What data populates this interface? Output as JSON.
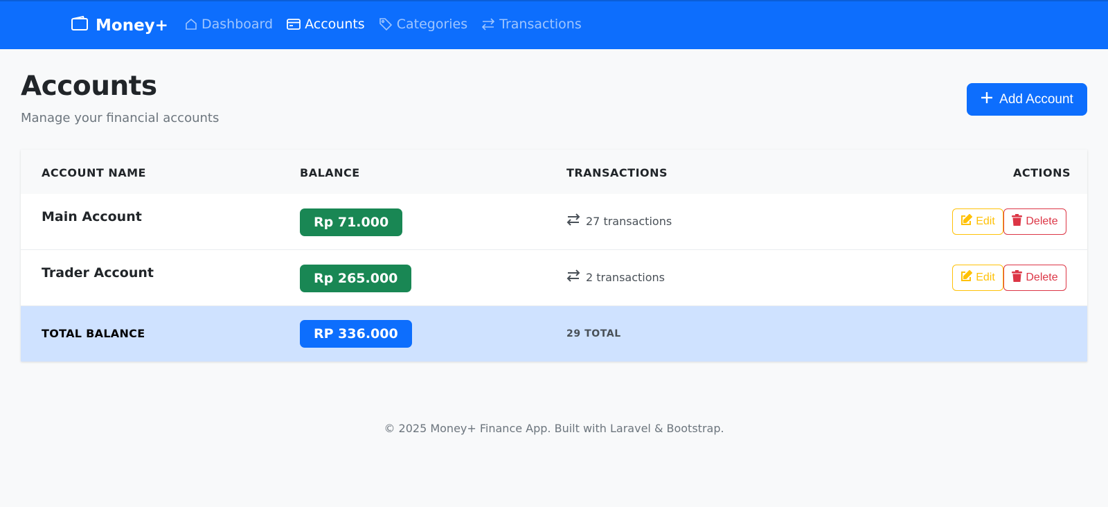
{
  "navbar": {
    "brand": "Money+",
    "links": [
      {
        "label": "Dashboard",
        "icon": "house-icon",
        "active": false
      },
      {
        "label": "Accounts",
        "icon": "credit-card-icon",
        "active": true
      },
      {
        "label": "Categories",
        "icon": "tags-icon",
        "active": false
      },
      {
        "label": "Transactions",
        "icon": "arrow-left-right-icon",
        "active": false
      }
    ]
  },
  "header": {
    "title": "Accounts",
    "subtitle": "Manage your financial accounts",
    "add_button_label": "Add Account"
  },
  "table": {
    "columns": [
      "Account Name",
      "Balance",
      "Transactions",
      "Actions"
    ],
    "rows": [
      {
        "name": "Main Account",
        "balance": "Rp 71.000",
        "transactions": "27 transactions",
        "edit_label": "Edit",
        "delete_label": "Delete"
      },
      {
        "name": "Trader Account",
        "balance": "Rp 265.000",
        "transactions": "2 transactions",
        "edit_label": "Edit",
        "delete_label": "Delete"
      }
    ],
    "total": {
      "label": "Total Balance",
      "balance": "RP 336.000",
      "transactions": "29 total"
    }
  },
  "footer": {
    "text": "© 2025 Money+ Finance App. Built with Laravel & Bootstrap."
  },
  "colors": {
    "primary": "#0d6efd",
    "success": "#198754",
    "warning": "#ffc107",
    "danger": "#dc3545",
    "total_row_bg": "#cfe2ff"
  }
}
